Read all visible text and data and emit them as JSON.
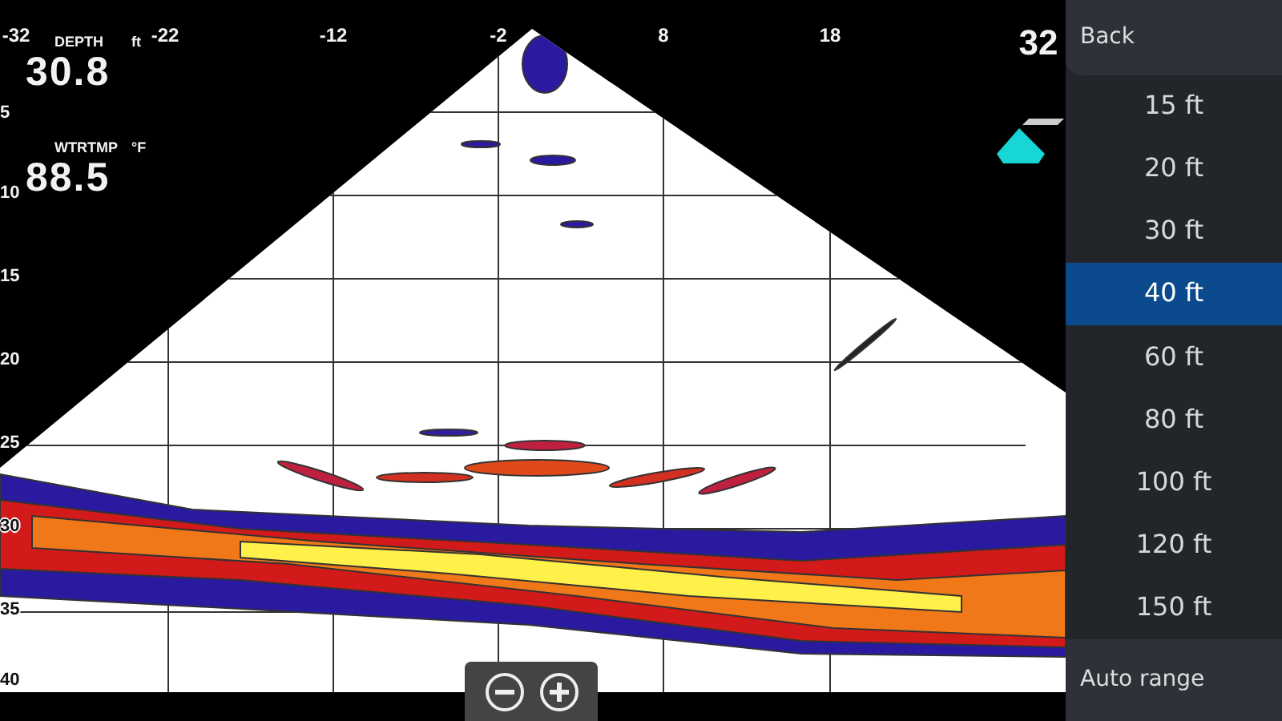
{
  "x_scale": [
    "-32",
    "-22",
    "-12",
    "-2",
    "8",
    "18",
    "32"
  ],
  "depth_scale": [
    "5",
    "10",
    "15",
    "20",
    "25",
    "30",
    "35",
    "40"
  ],
  "readouts": [
    {
      "label": "DEPTH",
      "unit": "ft",
      "value": "30.8"
    },
    {
      "label": "WTRTMP",
      "unit": "°F",
      "value": "88.5"
    }
  ],
  "range_menu": {
    "back": "Back",
    "options": [
      {
        "label": "15 ft",
        "selected": false
      },
      {
        "label": "20 ft",
        "selected": false
      },
      {
        "label": "30 ft",
        "selected": false
      },
      {
        "label": "40 ft",
        "selected": true
      },
      {
        "label": "60 ft",
        "selected": false
      },
      {
        "label": "80 ft",
        "selected": false
      },
      {
        "label": "100 ft",
        "selected": false
      },
      {
        "label": "120 ft",
        "selected": false
      },
      {
        "label": "150 ft",
        "selected": false
      }
    ],
    "auto": "Auto range"
  }
}
